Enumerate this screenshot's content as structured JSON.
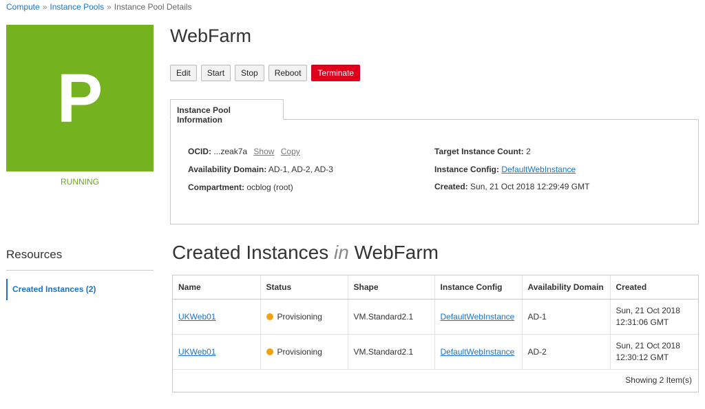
{
  "breadcrumb": {
    "items": [
      "Compute",
      "Instance Pools",
      "Instance Pool Details"
    ],
    "separator": "»"
  },
  "status_tile": {
    "letter": "P",
    "status": "RUNNING",
    "color": "#74b21f"
  },
  "page_title": "WebFarm",
  "actions": {
    "edit": "Edit",
    "start": "Start",
    "stop": "Stop",
    "reboot": "Reboot",
    "terminate": "Terminate"
  },
  "info": {
    "tab_label": "Instance Pool Information",
    "ocid_label": "OCID:",
    "ocid_value": "...zeak7a",
    "show_link": "Show",
    "copy_link": "Copy",
    "ad_label": "Availability Domain:",
    "ad_value": "AD-1, AD-2, AD-3",
    "compartment_label": "Compartment:",
    "compartment_value": "ocblog (root)",
    "target_label": "Target Instance Count:",
    "target_value": "2",
    "config_label": "Instance Config:",
    "config_value": "DefaultWebInstance",
    "created_label": "Created:",
    "created_value": "Sun, 21 Oct 2018 12:29:49 GMT"
  },
  "resources": {
    "title": "Resources",
    "items": [
      "Created Instances (2)"
    ]
  },
  "section": {
    "title_prefix": "Created Instances",
    "title_in": "in",
    "title_suffix": "WebFarm"
  },
  "table": {
    "columns": [
      "Name",
      "Status",
      "Shape",
      "Instance Config",
      "Availability Domain",
      "Created"
    ],
    "rows": [
      {
        "name": "UKWeb01",
        "status": "Provisioning",
        "status_color": "#f0a30a",
        "shape": "VM.Standard2.1",
        "config": "DefaultWebInstance",
        "ad": "AD-1",
        "created_line1": "Sun, 21 Oct 2018",
        "created_line2": "12:31:06 GMT"
      },
      {
        "name": "UKWeb01",
        "status": "Provisioning",
        "status_color": "#f0a30a",
        "shape": "VM.Standard2.1",
        "config": "DefaultWebInstance",
        "ad": "AD-2",
        "created_line1": "Sun, 21 Oct 2018",
        "created_line2": "12:30:12 GMT"
      }
    ],
    "footer": "Showing 2 Item(s)"
  }
}
